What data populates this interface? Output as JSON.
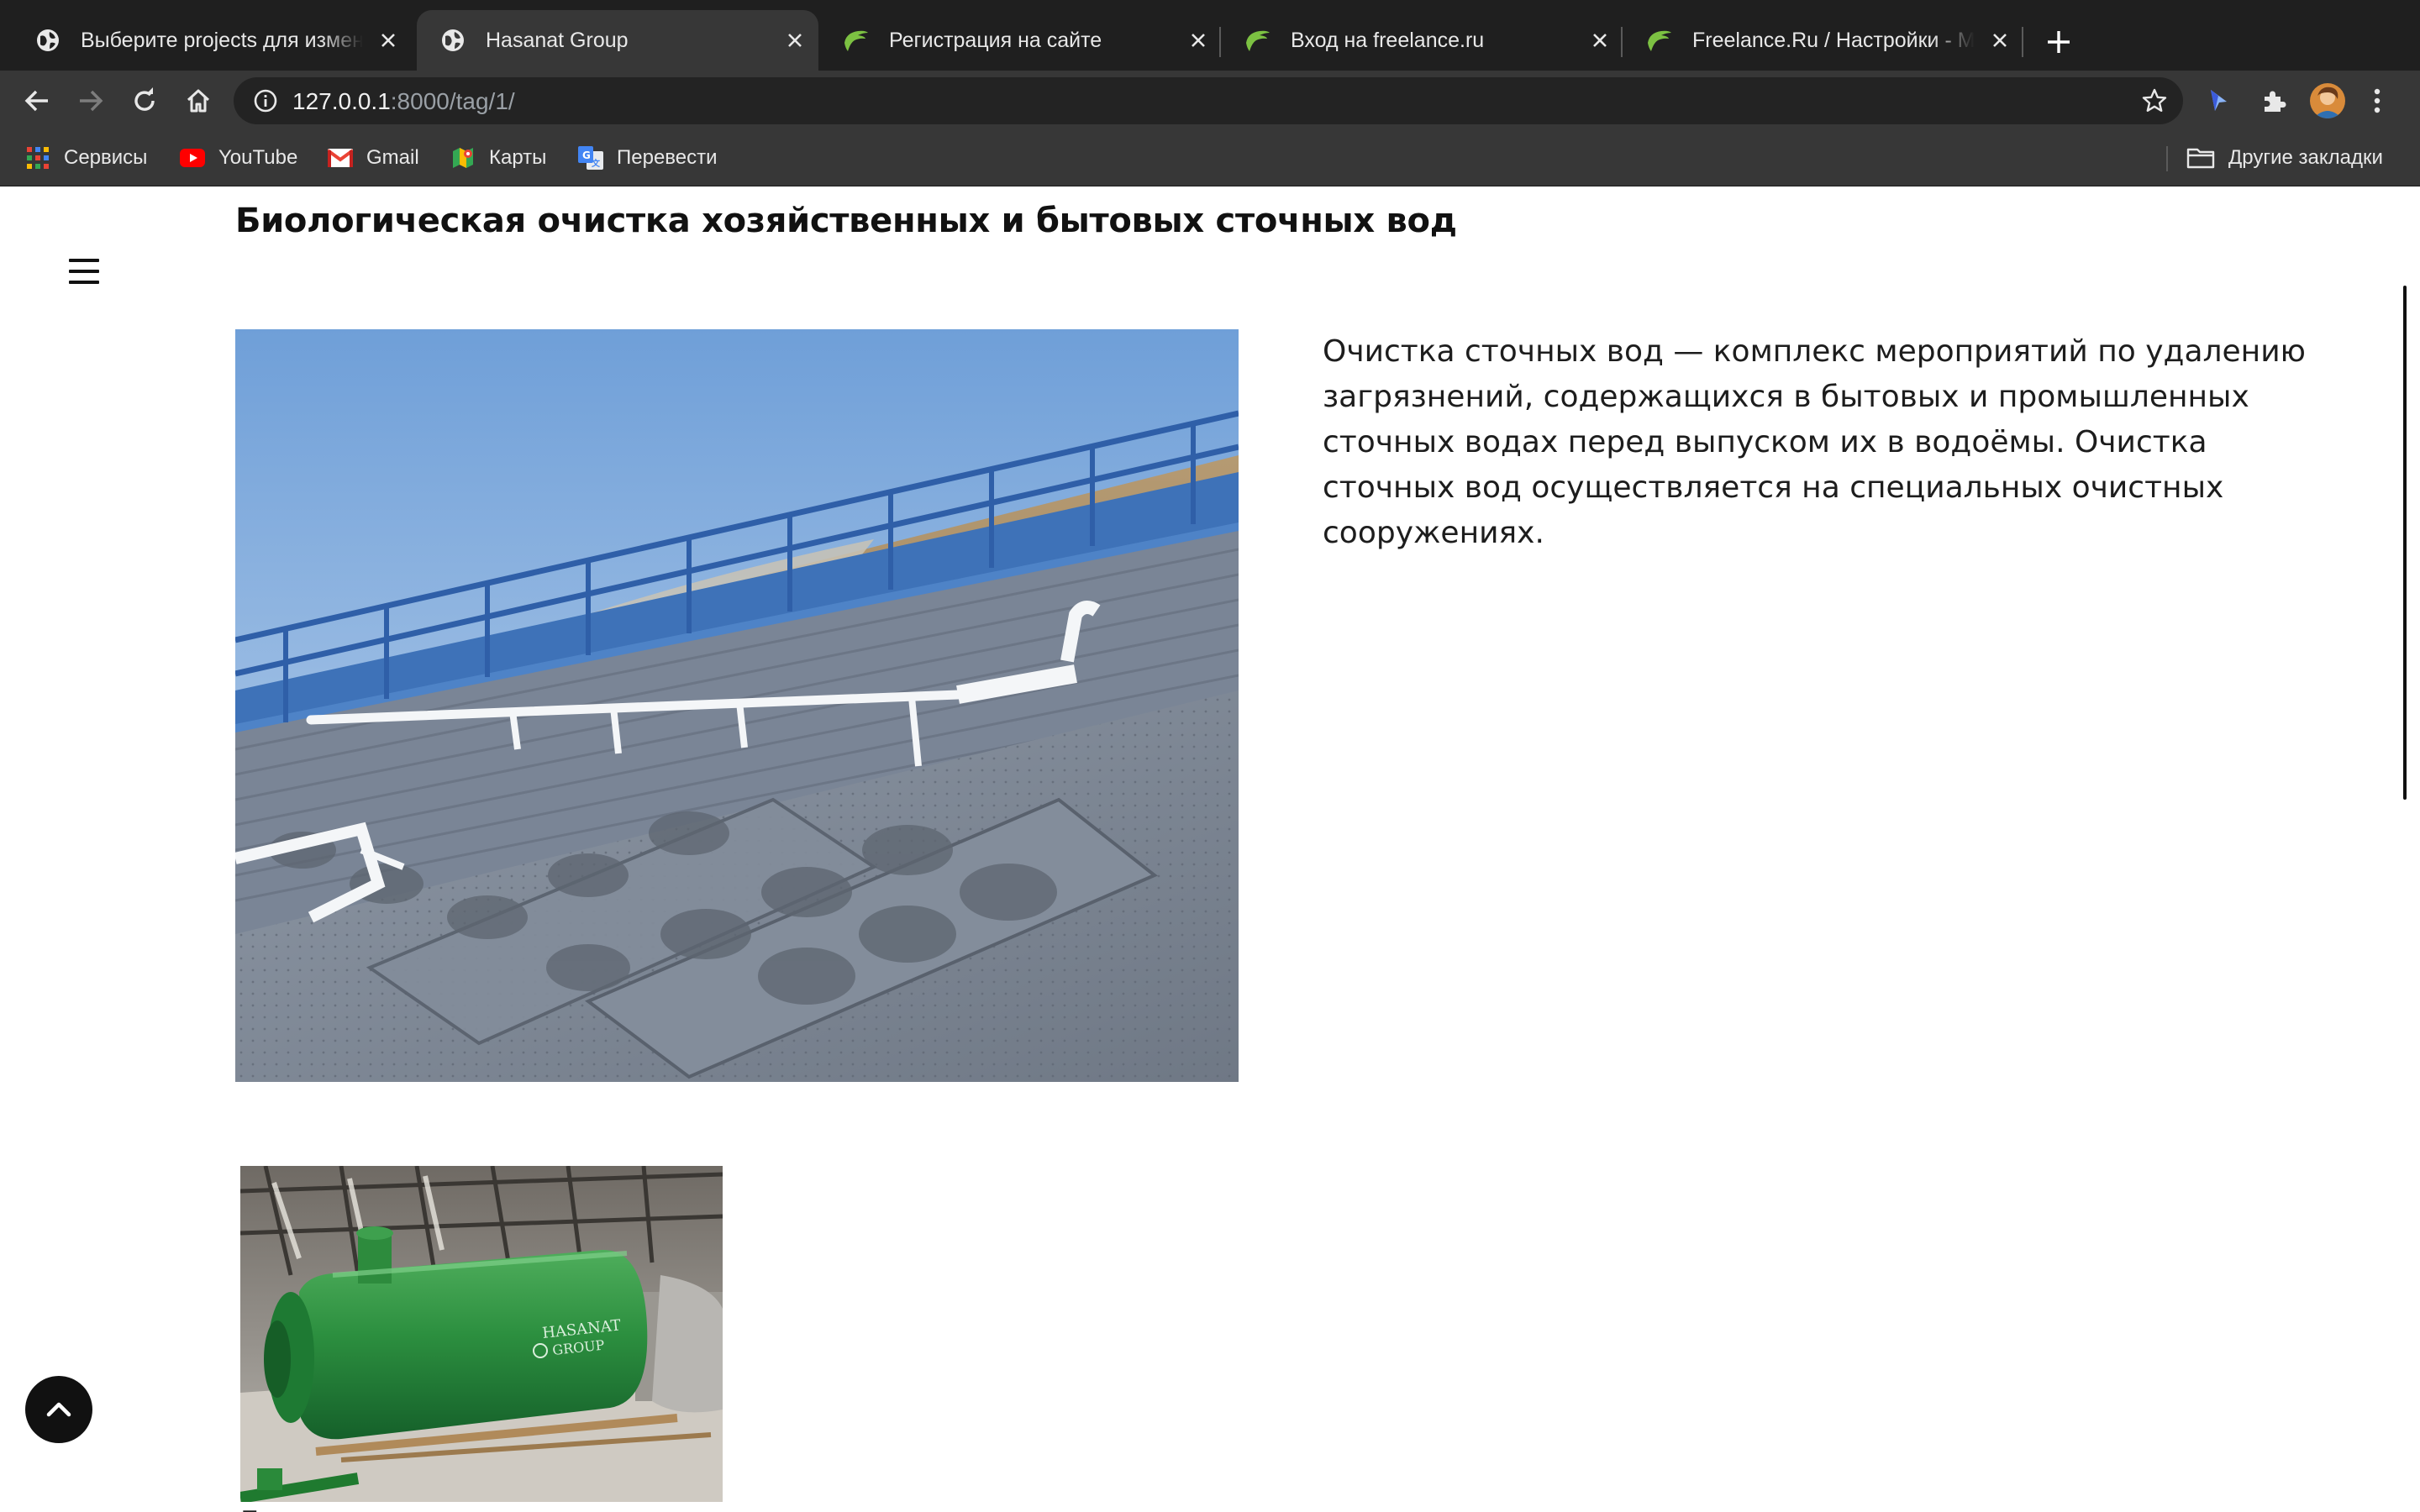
{
  "browser": {
    "tabs": [
      {
        "title": "Выберите projects для изменения",
        "icon": "globe-icon",
        "active": false
      },
      {
        "title": "Hasanat Group",
        "icon": "globe-icon",
        "active": true
      },
      {
        "title": "Регистрация на сайте",
        "icon": "freelance-leaf-icon",
        "active": false
      },
      {
        "title": "Вход на freelance.ru",
        "icon": "freelance-leaf-icon",
        "active": false
      },
      {
        "title": "Freelance.Ru / Настройки - Мой профиль",
        "icon": "freelance-leaf-icon",
        "active": false
      }
    ],
    "address": {
      "host": "127.0.0.1",
      "rest": ":8000/tag/1/"
    },
    "bookmarks": [
      {
        "label": "Сервисы",
        "icon": "apps-grid-icon"
      },
      {
        "label": "YouTube",
        "icon": "youtube-icon"
      },
      {
        "label": "Gmail",
        "icon": "gmail-icon"
      },
      {
        "label": "Карты",
        "icon": "maps-icon"
      },
      {
        "label": "Перевести",
        "icon": "translate-icon"
      }
    ],
    "other_bookmarks": "Другие закладки",
    "colors": {
      "tabbar": "#1f1f1f",
      "toolbar": "#373737",
      "omnibox": "#232323",
      "freelance_green": "#7cc142"
    }
  },
  "page": {
    "title": "Биологическая очистка хозяйственных и бытовых сточных вод",
    "description": "Очистка сточных вод — комплекс мероприятий по удалению загрязнений, содержащихся в бытовых и промышленных сточных водах перед выпуском их в водоёмы. Очистка сточных вод осуществляется на специальных очистных сооружениях.",
    "tank_label_line1": "HASANAT",
    "tank_label_line2": "GROUP",
    "cut_text": "Б"
  }
}
